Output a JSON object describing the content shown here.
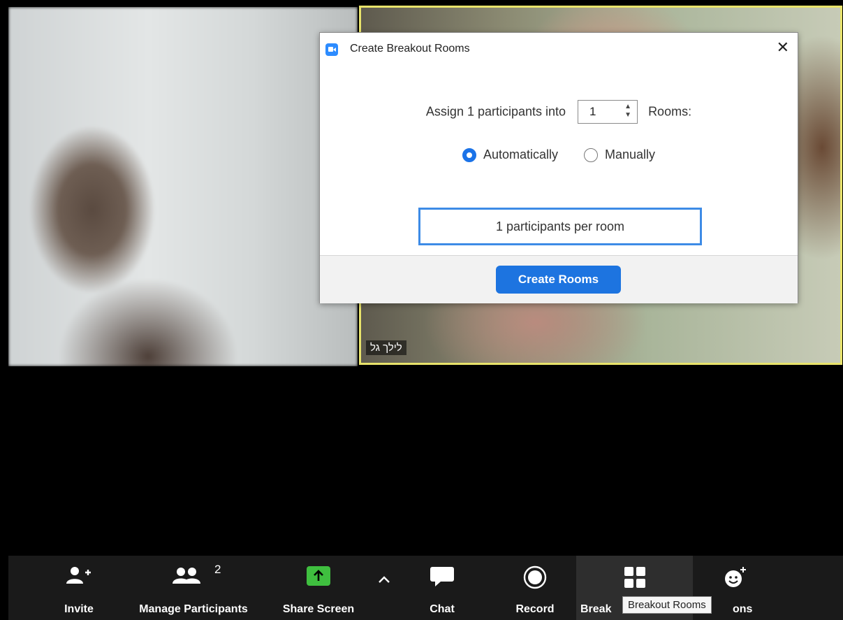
{
  "participant_name": "לילך גל",
  "dialog": {
    "title": "Create Breakout Rooms",
    "close_label": "✕",
    "assign_prefix": "Assign 1 participants into",
    "room_count": "1",
    "rooms_label": "Rooms:",
    "option_auto": "Automatically",
    "option_manual": "Manually",
    "selected_option": "Automatically",
    "per_room": "1 participants per room",
    "create_button": "Create Rooms"
  },
  "toolbar": {
    "invite": "Invite",
    "manage_participants": "Manage Participants",
    "participant_count": "2",
    "share_screen": "Share Screen",
    "chat": "Chat",
    "record": "Record",
    "breakout_partial": "Break",
    "reactions_partial": "ons"
  },
  "tooltip": "Breakout Rooms",
  "colors": {
    "accent": "#1d74e0",
    "share_green": "#3fbf3f",
    "active_speaker_border": "#e8e36b"
  }
}
